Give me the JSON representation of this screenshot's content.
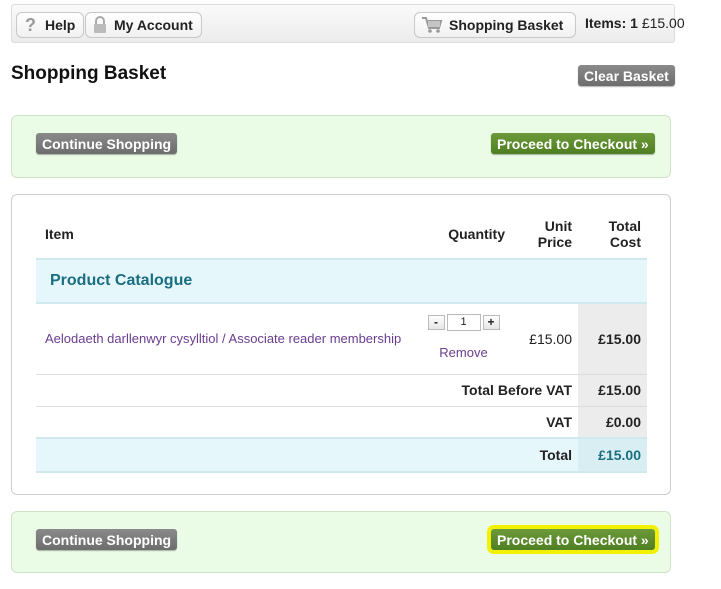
{
  "toolbar": {
    "help_label": "Help",
    "account_label": "My Account",
    "basket_label": "Shopping Basket",
    "items_label": "Items:",
    "items_count": "1",
    "items_total": "£15.00"
  },
  "page": {
    "title": "Shopping Basket",
    "clear_label": "Clear Basket",
    "continue_label": "Continue Shopping",
    "checkout_label": "Proceed to Checkout »"
  },
  "table": {
    "headers": {
      "item": "Item",
      "quantity": "Quantity",
      "unit_price_1": "Unit",
      "unit_price_2": "Price",
      "total_cost_1": "Total",
      "total_cost_2": "Cost"
    },
    "category": "Product Catalogue",
    "row": {
      "name": "Aelodaeth darllenwyr cysylltiol / Associate reader membership",
      "qty_minus": "-",
      "qty_value": "1",
      "qty_plus": "+",
      "remove": "Remove",
      "unit_price": "£15.00",
      "total": "£15.00"
    },
    "summary": {
      "before_vat_label": "Total Before VAT",
      "before_vat_value": "£15.00",
      "vat_label": "VAT",
      "vat_value": "£0.00",
      "total_label": "Total",
      "total_value": "£15.00"
    }
  },
  "colors": {
    "checkout_green": "#5a8a2c",
    "gray_button": "#7a7a7a",
    "highlight": "#f2f200",
    "category_text": "#1a6e80",
    "link_purple": "#6a3d8f"
  },
  "icons": [
    "help-icon",
    "lock-icon",
    "cart-icon"
  ]
}
